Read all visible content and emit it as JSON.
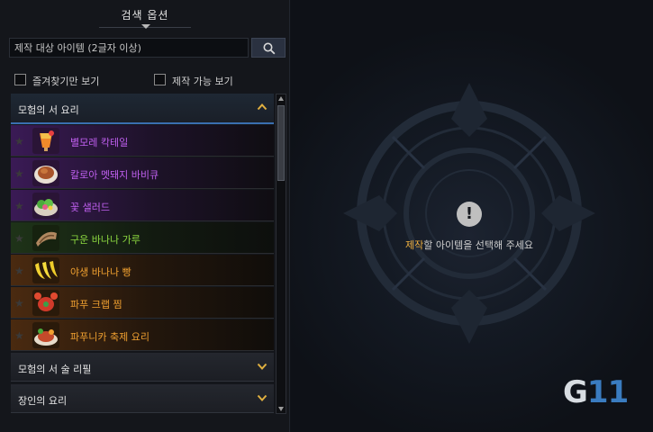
{
  "panel": {
    "title": "검색 옵션"
  },
  "search": {
    "placeholder": "제작 대상 아이템 (2글자 이상)",
    "button_icon": "search-icon"
  },
  "filters": [
    {
      "label": "즐겨찾기만 보기",
      "checked": false
    },
    {
      "label": "제작 가능 보기",
      "checked": false
    }
  ],
  "categories": {
    "open": {
      "label": "모험의 서 요리",
      "expanded": true
    },
    "collapsed": [
      {
        "label": "모험의 서 술 리필",
        "expanded": false
      },
      {
        "label": "장인의 요리",
        "expanded": false
      }
    ]
  },
  "items": [
    {
      "name": "별모레 칵테일",
      "grade": "purple",
      "icon": "cocktail-icon"
    },
    {
      "name": "칼로아 멧돼지 바비큐",
      "grade": "purple",
      "icon": "meat-icon"
    },
    {
      "name": "꽃 샐러드",
      "grade": "purple",
      "icon": "salad-icon"
    },
    {
      "name": "구운 바나나 가루",
      "grade": "green",
      "icon": "roasted-banana-icon"
    },
    {
      "name": "야생 바나나 빵",
      "grade": "orange",
      "icon": "banana-icon"
    },
    {
      "name": "파푸 크랩 찜",
      "grade": "orange",
      "icon": "crab-icon"
    },
    {
      "name": "파푸니카 축제 요리",
      "grade": "orange",
      "icon": "festival-dish-icon"
    }
  ],
  "detail": {
    "message_highlight": "제작",
    "message_rest": "할 아이템을 선택해 주세요",
    "icon": "alert-icon"
  },
  "watermark": {
    "g": "G",
    "n": "11"
  },
  "colors": {
    "purple": "#c060f0",
    "green": "#8cd840",
    "orange": "#f0a030",
    "accent": "#3a6fb0"
  }
}
